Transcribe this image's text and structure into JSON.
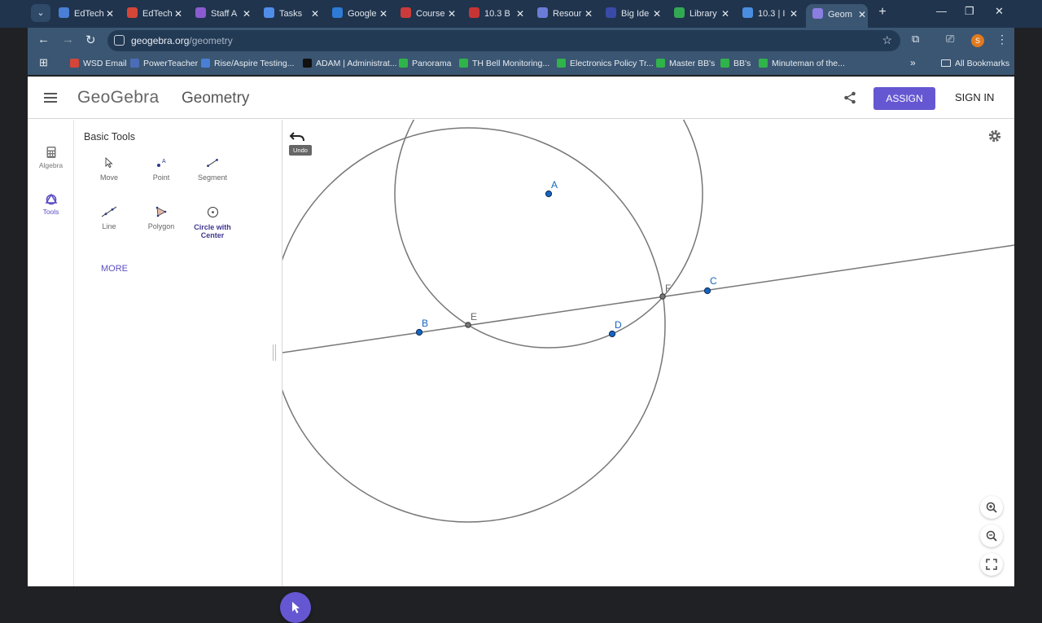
{
  "browser": {
    "tabs": [
      {
        "label": "EdTech",
        "color": "#4a7fd6"
      },
      {
        "label": "EdTech",
        "color": "#d44638"
      },
      {
        "label": "Staff A",
        "color": "#8a5cd0"
      },
      {
        "label": "Tasks",
        "color": "#4f8de8"
      },
      {
        "label": "Google",
        "color": "#2e7bd6"
      },
      {
        "label": "Course",
        "color": "#cc3b3b"
      },
      {
        "label": "10.3 B",
        "color": "#c73434"
      },
      {
        "label": "Resour",
        "color": "#6a7bd8"
      },
      {
        "label": "Big Ide",
        "color": "#3a4aa8"
      },
      {
        "label": "Library",
        "color": "#33a853"
      },
      {
        "label": "10.3 | I",
        "color": "#4b8de0"
      },
      {
        "label": "Geom",
        "color": "#8a7ee0"
      }
    ],
    "url_host": "geogebra.org",
    "url_path": "/geometry",
    "profile_initial": "S",
    "bookmarks": [
      {
        "label": "WSD Email",
        "color": "#d44638"
      },
      {
        "label": "PowerTeacher",
        "color": "#4b6cb7"
      },
      {
        "label": "Rise/Aspire Testing...",
        "color": "#4a7fd6"
      },
      {
        "label": "ADAM | Administrat...",
        "color": "#111111"
      },
      {
        "label": "Panorama",
        "color": "#2fb34a"
      },
      {
        "label": "TH Bell Monitoring...",
        "color": "#2fb34a"
      },
      {
        "label": "Electronics Policy Tr...",
        "color": "#2fb34a"
      },
      {
        "label": "Master BB's",
        "color": "#2fb34a"
      },
      {
        "label": "BB's",
        "color": "#2fb34a"
      },
      {
        "label": "Minuteman of the...",
        "color": "#2fb34a"
      }
    ],
    "all_bookmarks": "All Bookmarks"
  },
  "app": {
    "logo": "GeoGebra",
    "title": "Geometry",
    "assign": "ASSIGN",
    "signin": "SIGN IN",
    "accent": "#6557d2"
  },
  "rail": {
    "algebra": "Algebra",
    "tools": "Tools"
  },
  "tools": {
    "heading": "Basic Tools",
    "items": [
      "Move",
      "Point",
      "Segment",
      "Line",
      "Polygon",
      "Circle with Center"
    ],
    "more": "MORE"
  },
  "canvas": {
    "undo_tip": "Undo",
    "points": [
      "A",
      "B",
      "C",
      "D",
      "E",
      "F"
    ]
  }
}
